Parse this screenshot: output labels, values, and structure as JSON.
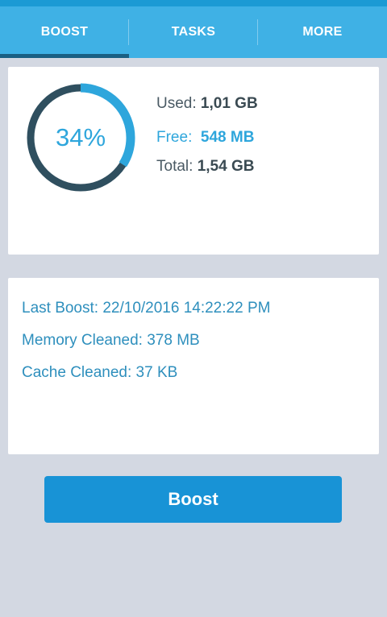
{
  "tabs": [
    {
      "label": "BOOST",
      "active": true
    },
    {
      "label": "TASKS",
      "active": false
    },
    {
      "label": "MORE",
      "active": false
    }
  ],
  "memory": {
    "percent_used": 34,
    "percent_label": "34%",
    "used_label": "Used:",
    "used_value": "1,01 GB",
    "free_label": "Free:",
    "free_value": "548 MB",
    "total_label": "Total:",
    "total_value": "1,54 GB"
  },
  "stats": {
    "last_boost": "Last Boost: 22/10/2016 14:22:22 PM",
    "memory_cleaned": "Memory Cleaned: 378 MB",
    "cache_cleaned": "Cache Cleaned: 37 KB"
  },
  "actions": {
    "boost_label": "Boost"
  },
  "colors": {
    "accent": "#3fb1e5",
    "ring_used": "#2ea6dc",
    "ring_track": "#2f4f5f",
    "button": "#1893d6",
    "background": "#d3d8e2"
  }
}
